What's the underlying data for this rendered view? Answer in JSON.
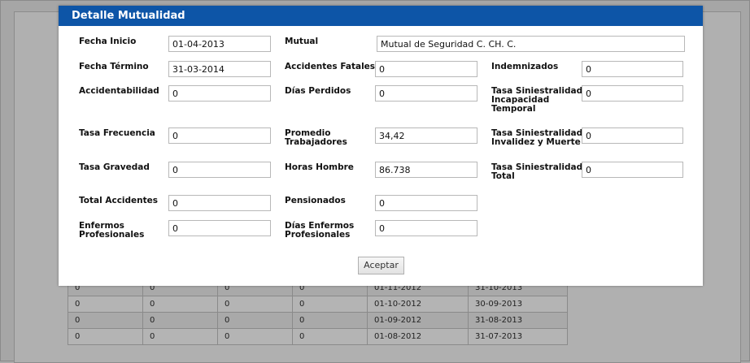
{
  "dialog": {
    "title": "Detalle Mutualidad",
    "accept_label": "Aceptar"
  },
  "fields": {
    "fecha_inicio": {
      "label": "Fecha Inicio",
      "value": "01-04-2013"
    },
    "mutual": {
      "label": "Mutual",
      "value": "Mutual de Seguridad C. CH. C."
    },
    "fecha_termino": {
      "label": "Fecha Término",
      "value": "31-03-2014"
    },
    "accidentes_fatales": {
      "label": "Accidentes Fatales",
      "value": "0"
    },
    "indemnizados": {
      "label": "Indemnizados",
      "value": "0"
    },
    "accidentabilidad": {
      "label": "Accidentabilidad",
      "value": "0"
    },
    "dias_perdidos": {
      "label": "Días Perdidos",
      "value": "0"
    },
    "tasa_sin_incapacidad": {
      "label_lines": [
        "Tasa Siniestralidad",
        "Incapacidad",
        "Temporal"
      ],
      "value": "0"
    },
    "tasa_frecuencia": {
      "label": "Tasa Frecuencia",
      "value": "0"
    },
    "promedio_trabajadores": {
      "label_lines": [
        "Promedio",
        "Trabajadores"
      ],
      "value": "34,42"
    },
    "tasa_sin_invalidez": {
      "label_lines": [
        "Tasa Siniestralidad",
        "Invalidez y Muerte"
      ],
      "value": "0"
    },
    "tasa_gravedad": {
      "label": "Tasa Gravedad",
      "value": "0"
    },
    "horas_hombre": {
      "label": "Horas Hombre",
      "value": "86.738"
    },
    "tasa_sin_total": {
      "label_lines": [
        "Tasa Siniestralidad",
        "Total"
      ],
      "value": "0"
    },
    "total_accidentes": {
      "label": "Total Accidentes",
      "value": "0"
    },
    "pensionados": {
      "label": "Pensionados",
      "value": "0"
    },
    "enfermos_profesionales": {
      "label_lines": [
        "Enfermos",
        "Profesionales"
      ],
      "value": "0"
    },
    "dias_enfermos_profesionales": {
      "label_lines": [
        "Días Enfermos",
        "Profesionales"
      ],
      "value": "0"
    }
  },
  "background_table": {
    "rows": [
      [
        "0",
        "0",
        "0",
        "0",
        "01-11-2012",
        "31-10-2013"
      ],
      [
        "0",
        "0",
        "0",
        "0",
        "01-10-2012",
        "30-09-2013"
      ],
      [
        "0",
        "0",
        "0",
        "0",
        "01-09-2012",
        "31-08-2013"
      ],
      [
        "0",
        "0",
        "0",
        "0",
        "01-08-2012",
        "31-07-2013"
      ]
    ]
  }
}
